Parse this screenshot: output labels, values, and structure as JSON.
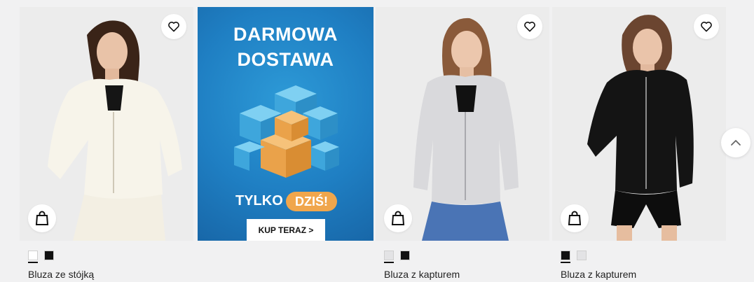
{
  "products": [
    {
      "name": "Bluza ze stójką",
      "colors": [
        "#ffffff",
        "#111111"
      ],
      "selected_color": 0
    },
    {
      "name": "Bluza z kapturem",
      "colors": [
        "#e3e3e5",
        "#111111"
      ],
      "selected_color": 0
    },
    {
      "name": "Bluza z kapturem",
      "colors": [
        "#111111",
        "#e3e3e5"
      ],
      "selected_color": 0
    }
  ],
  "promo": {
    "line1": "DARMOWA",
    "line2": "DOSTAWA",
    "tylko": "TYLKO",
    "dzis": "DZIŚ!",
    "cta": "KUP TERAZ >"
  },
  "icons": {
    "favorite": "heart-icon",
    "cart": "shopping-bag-icon",
    "scroll_top": "chevron-up-icon"
  },
  "colors": {
    "promo_blue": "#1f7fc3",
    "promo_orange": "#f0a64c",
    "page_bg": "#f1f1f2"
  }
}
